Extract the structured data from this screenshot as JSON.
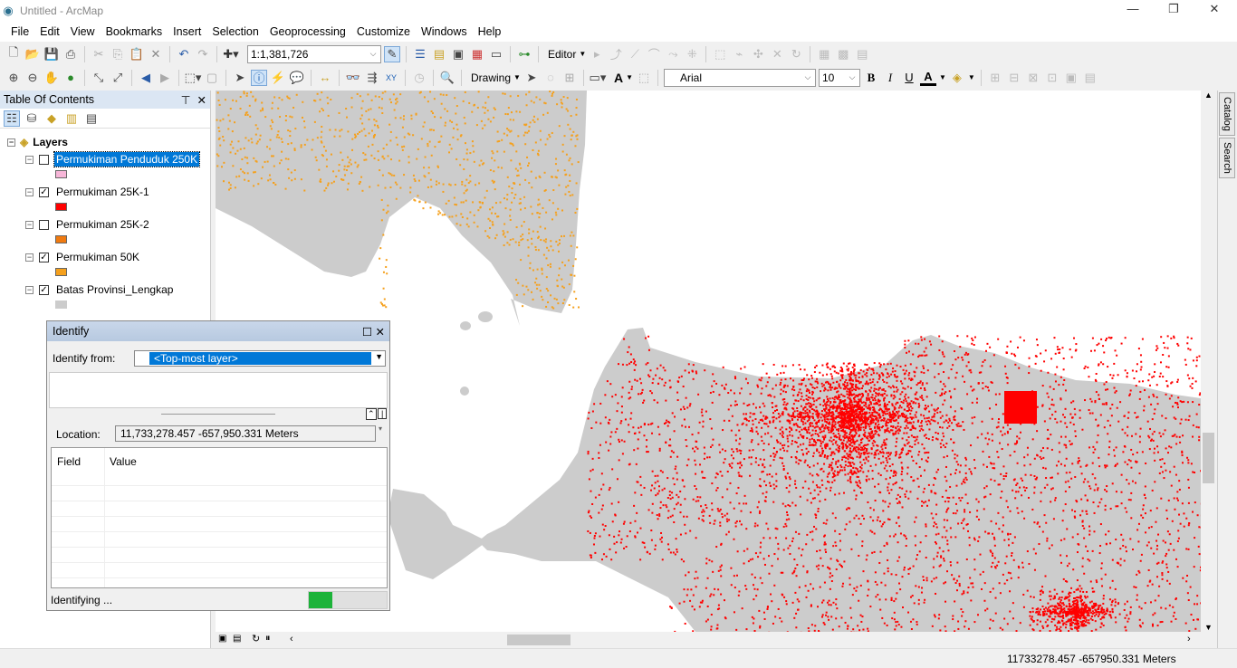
{
  "window": {
    "title": "Untitled - ArcMap",
    "controls": [
      "—",
      "❐",
      "✕"
    ]
  },
  "menu": [
    "File",
    "Edit",
    "View",
    "Bookmarks",
    "Insert",
    "Selection",
    "Geoprocessing",
    "Customize",
    "Windows",
    "Help"
  ],
  "toolbar": {
    "scale": "1:1,381,726",
    "editor": "Editor",
    "drawing": "Drawing",
    "font": "Arial",
    "font_size": "10",
    "bold": "B",
    "italic": "I",
    "underline": "U",
    "text_tool": "A"
  },
  "toc": {
    "title": "Table Of Contents",
    "root": "Layers",
    "layers": [
      {
        "name": "Permukiman Penduduk 250K",
        "checked": false,
        "color": "#f7b6d8",
        "selected": true
      },
      {
        "name": "Permukiman 25K-1",
        "checked": true,
        "color": "#ff0000"
      },
      {
        "name": "Permukiman 25K-2",
        "checked": false,
        "color": "#f07a10"
      },
      {
        "name": "Permukiman 50K",
        "checked": true,
        "color": "#f5a01c"
      },
      {
        "name": "Batas Provinsi_Lengkap",
        "checked": true,
        "color": "#cccccc"
      }
    ]
  },
  "identify": {
    "title": "Identify",
    "from_label": "Identify from:",
    "from_value": "<Top-most layer>",
    "location_label": "Location:",
    "location_value": "11,733,278.457  -657,950.331 Meters",
    "col_field": "Field",
    "col_value": "Value",
    "status": "Identifying ...",
    "progress": 0.3
  },
  "side_tabs": [
    "Catalog",
    "Search"
  ],
  "status": {
    "coords": "11733278.457  -657950.331 Meters"
  },
  "colors": {
    "land": "#cccccc",
    "settlement_25k": "#ff0000",
    "settlement_50k": "#f5a01c",
    "progress": "#1db33a",
    "selection": "#0078d7"
  }
}
